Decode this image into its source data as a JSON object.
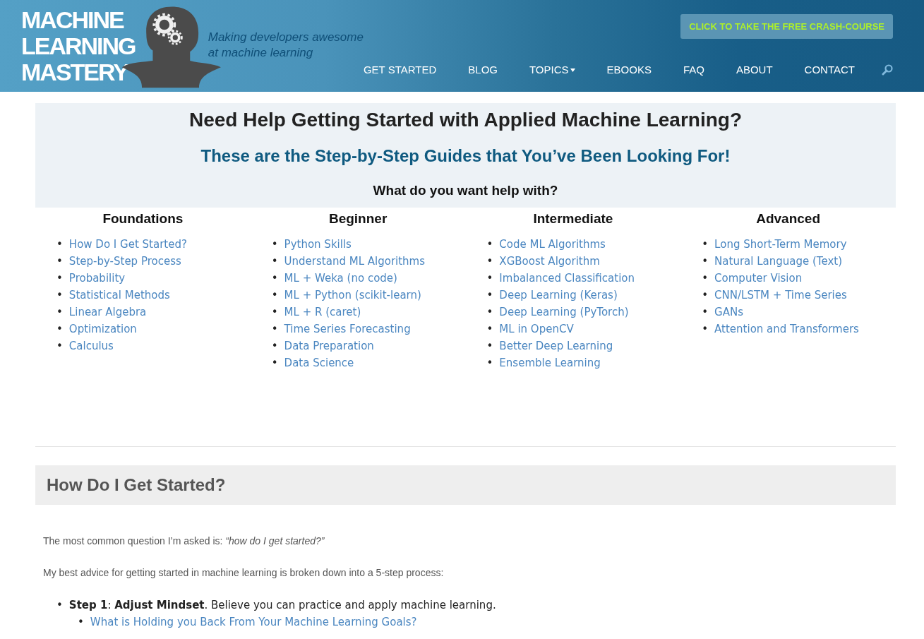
{
  "header": {
    "logo_lines": [
      "MACHINE",
      "LEARNING",
      "MASTERY"
    ],
    "tagline_lines": [
      "Making developers awesome",
      "at machine learning"
    ],
    "cta": "CLICK TO TAKE THE FREE CRASH-COURSE",
    "nav": [
      {
        "label": "GET STARTED",
        "dropdown": false
      },
      {
        "label": "BLOG",
        "dropdown": false
      },
      {
        "label": "TOPICS",
        "dropdown": true
      },
      {
        "label": "EBOOKS",
        "dropdown": false
      },
      {
        "label": "FAQ",
        "dropdown": false
      },
      {
        "label": "ABOUT",
        "dropdown": false
      },
      {
        "label": "CONTACT",
        "dropdown": false
      }
    ]
  },
  "bullet": "•",
  "guides": {
    "title": "Need Help Getting Started with Applied Machine Learning?",
    "subtitle": "These are the Step-by-Step Guides that You’ve Been Looking For!",
    "question": "What do you want help with?",
    "columns": [
      {
        "heading": "Foundations",
        "links": [
          "How Do I Get Started?",
          "Step-by-Step Process",
          "Probability",
          "Statistical Methods",
          "Linear Algebra",
          "Optimization",
          "Calculus"
        ]
      },
      {
        "heading": "Beginner",
        "links": [
          "Python Skills",
          "Understand ML Algorithms",
          "ML + Weka (no code)",
          "ML + Python (scikit-learn)",
          "ML + R (caret)",
          "Time Series Forecasting",
          "Data Preparation",
          "Data Science"
        ]
      },
      {
        "heading": "Intermediate",
        "links": [
          "Code ML Algorithms",
          "XGBoost Algorithm",
          "Imbalanced Classification",
          "Deep Learning (Keras)",
          "Deep Learning (PyTorch)",
          "ML in OpenCV",
          "Better Deep Learning",
          "Ensemble Learning"
        ]
      },
      {
        "heading": "Advanced",
        "links": [
          "Long Short-Term Memory",
          "Natural Language (Text)",
          "Computer Vision",
          "CNN/LSTM + Time Series",
          "GANs",
          "Attention and Transformers"
        ]
      }
    ]
  },
  "section": {
    "heading": "How Do I Get Started?",
    "paragraphs": [
      "The most common question I’m asked is: *“how do I get started?”*",
      "My best advice for getting started in machine learning is broken down into a 5-step process:"
    ],
    "steps": [
      {
        "text": "**Step 1**: **Adjust Mindset**. Believe you can practice and apply machine learning.",
        "links": [
          "What is Holding you Back From Your Machine Learning Goals?"
        ]
      }
    ]
  }
}
